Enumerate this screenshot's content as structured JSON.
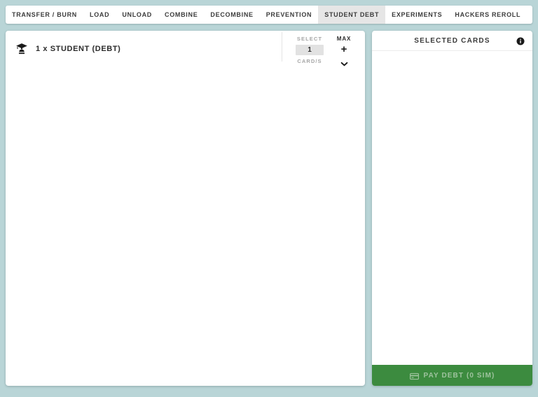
{
  "theme": {
    "background": "#b9d5d7",
    "panel": "#ffffff",
    "active_tab": "#e6e6e6",
    "accent_green": "#3c8b3f",
    "muted_text": "#a6a6a6",
    "pay_label_color": "#9ec39e"
  },
  "tabs": [
    {
      "label": "TRANSFER / BURN",
      "active": false
    },
    {
      "label": "LOAD",
      "active": false
    },
    {
      "label": "UNLOAD",
      "active": false
    },
    {
      "label": "COMBINE",
      "active": false
    },
    {
      "label": "DECOMBINE",
      "active": false
    },
    {
      "label": "PREVENTION",
      "active": false
    },
    {
      "label": "STUDENT DEBT",
      "active": true
    },
    {
      "label": "EXPERIMENTS",
      "active": false
    },
    {
      "label": "HACKERS REROLL",
      "active": false
    }
  ],
  "left_panel": {
    "cards": [
      {
        "icon": "student-graduation-cap-icon",
        "label": "1 x STUDENT (DEBT)",
        "select": {
          "caption": "SELECT",
          "value": "1",
          "unit": "CARD/S"
        },
        "max": {
          "caption": "MAX",
          "plus": "+",
          "chevron": "chevron-down-icon"
        }
      }
    ]
  },
  "right_panel": {
    "title": "SELECTED CARDS",
    "info_icon": "info-icon",
    "items": [],
    "pay_button": {
      "icon": "credit-card-icon",
      "label": "PAY DEBT (0 SIM)"
    }
  }
}
